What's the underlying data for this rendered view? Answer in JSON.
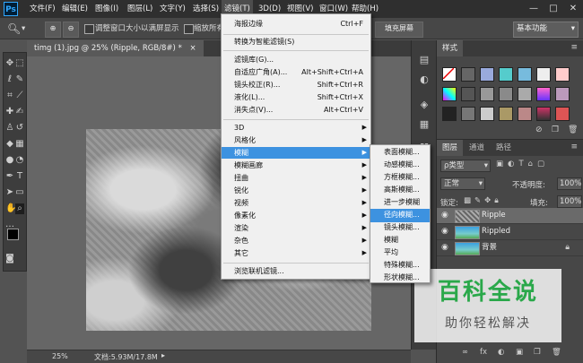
{
  "menubar": {
    "logo": "Ps",
    "items": [
      "文件(F)",
      "编辑(E)",
      "图像(I)",
      "图层(L)",
      "文字(Y)",
      "选择(S)",
      "滤镜(T)",
      "3D(D)",
      "视图(V)",
      "窗口(W)",
      "帮助(H)"
    ],
    "window_controls": [
      "—",
      "□",
      "✕"
    ]
  },
  "options_bar": {
    "zoom_in": "⊕",
    "zoom_out": "⊖",
    "resize_windows": "调整窗口大小以满屏显示",
    "zoom_all": "缩放所有",
    "fill_screen": "填充屏幕",
    "workspace": "基本功能"
  },
  "document": {
    "tab_title": "timg (1).jpg @ 25% (Ripple, RGB/8#) *",
    "tab_close": "×"
  },
  "status": {
    "zoom": "25%",
    "doc_size": "文档:5.93M/17.8M"
  },
  "filter_menu": {
    "items": [
      {
        "label": "海报边缘",
        "shortcut": "Ctrl+F"
      },
      {
        "label": "转换为智能滤镜(S)"
      },
      {
        "label": "滤镜库(G)..."
      },
      {
        "label": "自适应广角(A)...",
        "shortcut": "Alt+Shift+Ctrl+A"
      },
      {
        "label": "镜头校正(R)...",
        "shortcut": "Shift+Ctrl+R"
      },
      {
        "label": "液化(L)...",
        "shortcut": "Shift+Ctrl+X"
      },
      {
        "label": "消失点(V)...",
        "shortcut": "Alt+Ctrl+V"
      },
      {
        "label": "3D"
      },
      {
        "label": "风格化"
      },
      {
        "label": "模糊"
      },
      {
        "label": "模糊画廊"
      },
      {
        "label": "扭曲"
      },
      {
        "label": "锐化"
      },
      {
        "label": "视频"
      },
      {
        "label": "像素化"
      },
      {
        "label": "渲染"
      },
      {
        "label": "杂色"
      },
      {
        "label": "其它"
      },
      {
        "label": "浏览联机滤镜..."
      }
    ]
  },
  "blur_submenu": {
    "items": [
      "表面模糊...",
      "动感模糊...",
      "方框模糊...",
      "高斯模糊...",
      "进一步模糊",
      "径向模糊...",
      "镜头模糊...",
      "模糊",
      "平均",
      "特殊模糊...",
      "形状模糊..."
    ],
    "highlighted": "径向模糊..."
  },
  "styles_panel": {
    "tab": "样式"
  },
  "layers_panel": {
    "tabs": [
      "图层",
      "通道",
      "路径"
    ],
    "filter_type": "ρ类型",
    "blend_mode": "正常",
    "opacity_label": "不透明度:",
    "opacity_value": "100%",
    "lock_label": "锁定:",
    "fill_label": "填充:",
    "fill_value": "100%",
    "layers": [
      {
        "name": "Ripple",
        "selected": true
      },
      {
        "name": "Rippled",
        "selected": false
      },
      {
        "name": "背景",
        "selected": false,
        "locked": true
      }
    ],
    "bottom_icons": [
      "∞",
      "fx",
      "◐",
      "▣",
      "❐",
      "🗑"
    ]
  },
  "watermark": {
    "title": "百科全说",
    "subtitle": "助你轻松解决"
  },
  "colors": {
    "highlight": "#3d92e0",
    "brand_green": "#2aa84a"
  }
}
